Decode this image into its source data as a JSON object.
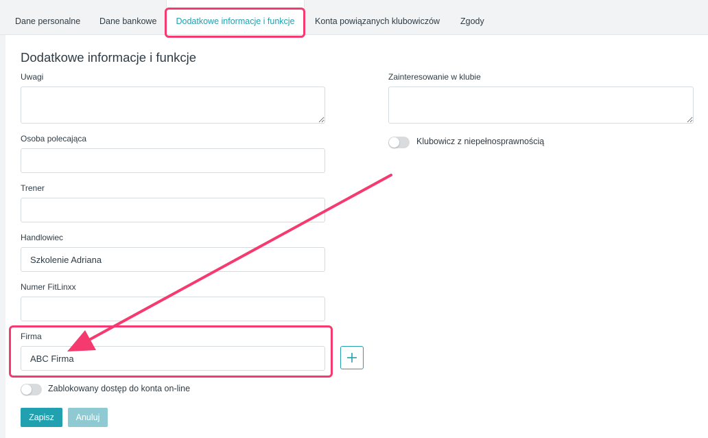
{
  "tabs": [
    {
      "label": "Dane personalne"
    },
    {
      "label": "Dane bankowe"
    },
    {
      "label": "Dodatkowe informacje i funkcje"
    },
    {
      "label": "Konta powiązanych klubowiczów"
    },
    {
      "label": "Zgody"
    }
  ],
  "active_tab": "Dodatkowe informacje i funkcje",
  "section": {
    "title": "Dodatkowe informacje i funkcje"
  },
  "fields": {
    "uwagi": {
      "label": "Uwagi",
      "value": ""
    },
    "osoba_polecajaca": {
      "label": "Osoba polecająca",
      "value": ""
    },
    "trener": {
      "label": "Trener",
      "value": ""
    },
    "handlowiec": {
      "label": "Handlowiec",
      "value": "Szkolenie Adriana"
    },
    "numer_fitlinxx": {
      "label": "Numer FitLinxx",
      "value": ""
    },
    "firma": {
      "label": "Firma",
      "value": "ABC Firma"
    },
    "zainteresowanie": {
      "label": "Zainteresowanie w klubie",
      "value": ""
    }
  },
  "toggles": {
    "niepelnosprawnosc": {
      "label": "Klubowicz z niepełnosprawnością",
      "on": false
    },
    "zablokowany_dostep": {
      "label": "Zablokowany dostęp do konta on-line",
      "on": false
    }
  },
  "buttons": {
    "add_icon": "plus-icon",
    "save_label": "Zapisz",
    "cancel_label": "Anuluj"
  },
  "colors": {
    "accent": "#21a0b0",
    "accent_disabled": "#8fcad3",
    "annotation": "#f43a6e"
  }
}
